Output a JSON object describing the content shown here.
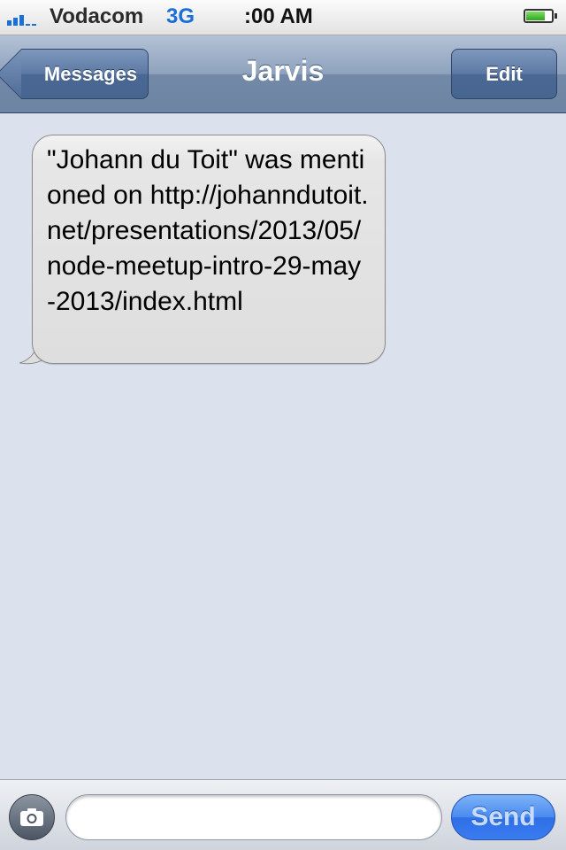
{
  "status_bar": {
    "carrier": "Vodacom",
    "network": "3G",
    "time": ":00 AM",
    "battery_level": 0.7
  },
  "nav_bar": {
    "back_label": "Messages",
    "title": "Jarvis",
    "edit_label": "Edit"
  },
  "messages": [
    {
      "direction": "incoming",
      "text": "\"Johann du Toit\" was mentioned on http://johanndutoit.net/presentations/2013/05/node-meetup-intro-29-may-2013/index.html"
    }
  ],
  "composer": {
    "input_value": "",
    "send_label": "Send"
  },
  "colors": {
    "accent": "#1a6ed8",
    "background": "#dbe1ed",
    "nav": "#6d84a3",
    "send": "#3a7cf0"
  }
}
